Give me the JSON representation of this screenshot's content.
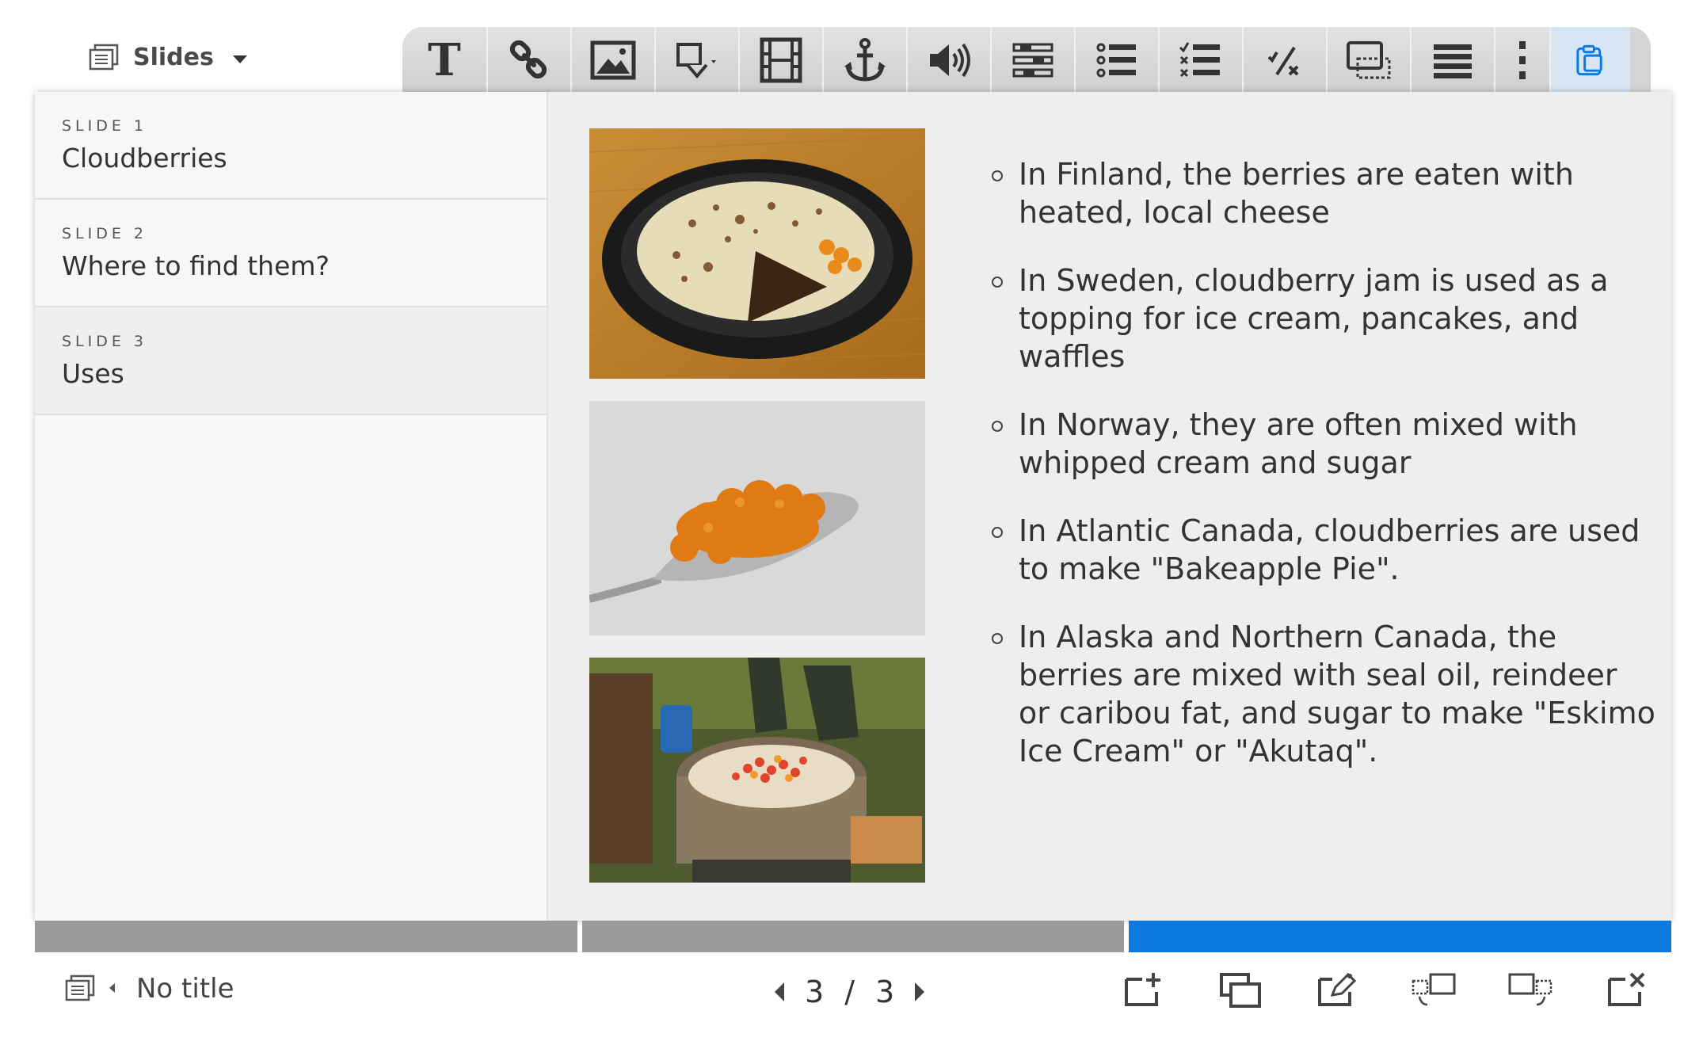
{
  "header": {
    "menu_label": "Slides"
  },
  "toolbar": {
    "text_tool_glyph": "T",
    "icons": [
      "text-icon",
      "link-icon",
      "image-icon",
      "shape-icon",
      "video-icon",
      "anchor-icon",
      "audio-icon",
      "layout-icon",
      "bullet-list-icon",
      "checklist-icon",
      "math-icon",
      "slide-settings-icon",
      "lines-icon",
      "more-icon",
      "clipboard-icon"
    ],
    "accent_color": "#0a79e0"
  },
  "sidebar": {
    "items": [
      {
        "number": "SLIDE 1",
        "title": "Cloudberries"
      },
      {
        "number": "SLIDE 2",
        "title": "Where to find them?"
      },
      {
        "number": "SLIDE 3",
        "title": "Uses"
      }
    ]
  },
  "slide": {
    "bullets": [
      "In Finland, the berries are eaten with heated, local cheese",
      "In Sweden, cloudberry jam is used as a topping for ice cream, pancakes, and waffles",
      "In Norway, they are often mixed with whipped cream and sugar",
      "In Atlantic Canada, cloudberries are used to make \"Bakeapple Pie\".",
      "In Alaska and Northern Canada, the berries are mixed with seal oil, reindeer or caribou fat, and sugar to make \"Eskimo Ice Cream\" or \"Akutaq\"."
    ]
  },
  "progress": {
    "total": 3,
    "current": 3
  },
  "footer": {
    "title": "No title",
    "current_page": "3",
    "separator": "/",
    "total_pages": "3",
    "actions": [
      "add-slide-icon",
      "duplicate-slide-icon",
      "edit-slide-icon",
      "move-slide-before-icon",
      "move-slide-after-icon",
      "delete-slide-icon"
    ]
  }
}
